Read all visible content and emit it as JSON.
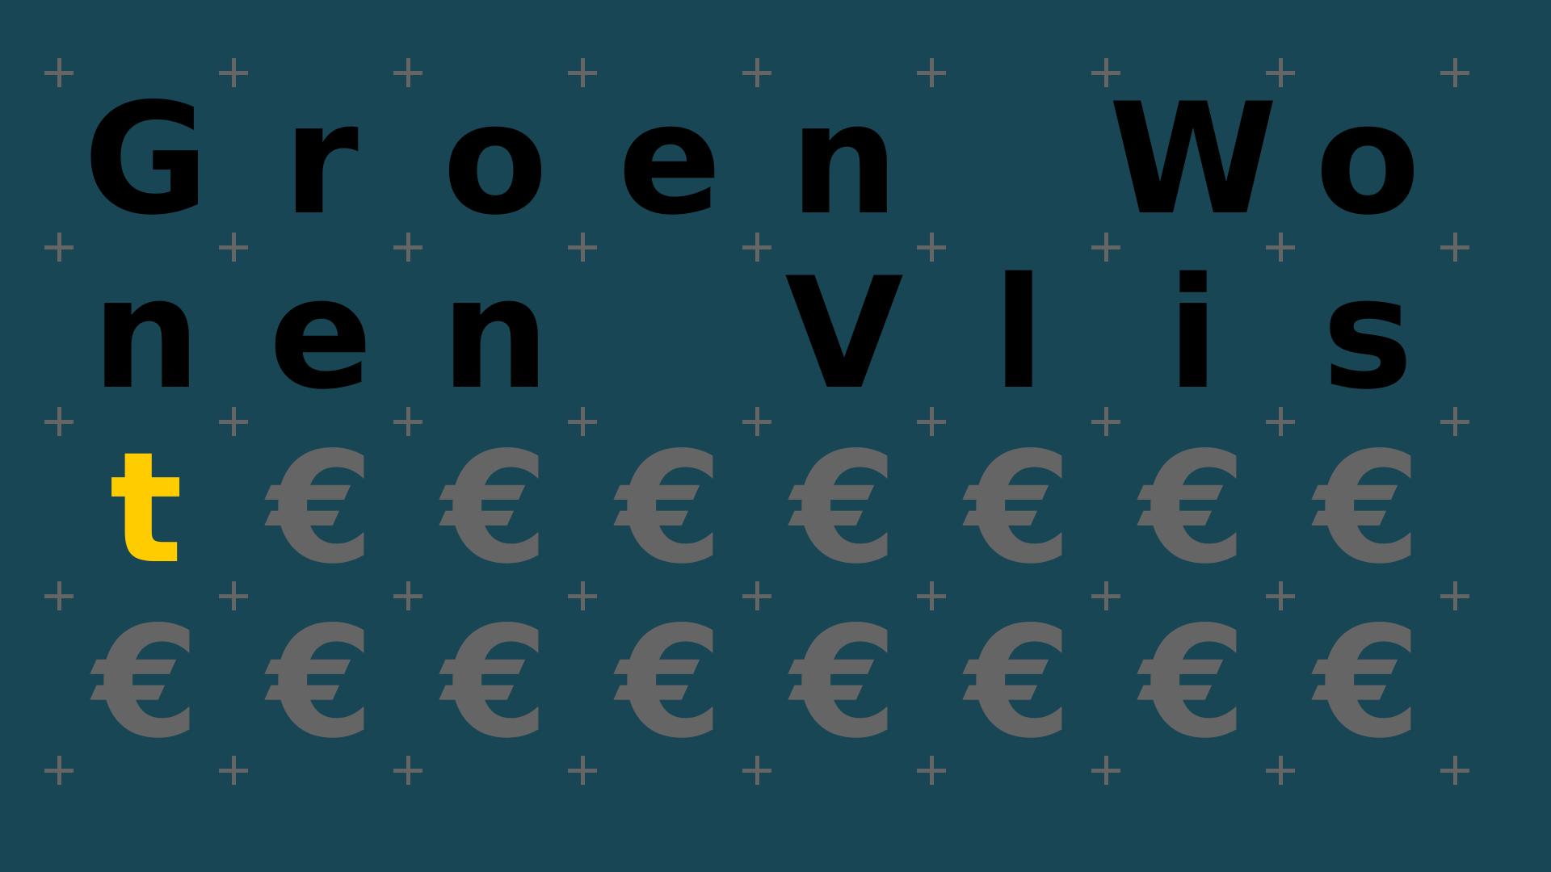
{
  "puzzle": {
    "rows": [
      [
        "G",
        "r",
        "o",
        "e",
        "n",
        "",
        "W",
        "o"
      ],
      [
        "n",
        "e",
        "n",
        "",
        "V",
        "l",
        "i",
        "s"
      ],
      [
        "t",
        "€",
        "€",
        "€",
        "€",
        "€",
        "€",
        "€"
      ],
      [
        "€",
        "€",
        "€",
        "€",
        "€",
        "€",
        "€",
        "€"
      ]
    ],
    "colors": {
      "background": "#184655",
      "letter": "#000000",
      "highlight": "#ffcc00",
      "filler": "#656565",
      "grid_marker": "#656565"
    },
    "highlighted_cell": {
      "row": 2,
      "col": 0
    },
    "filler_glyph": "€",
    "grid_marker_icon": "plus-icon"
  }
}
